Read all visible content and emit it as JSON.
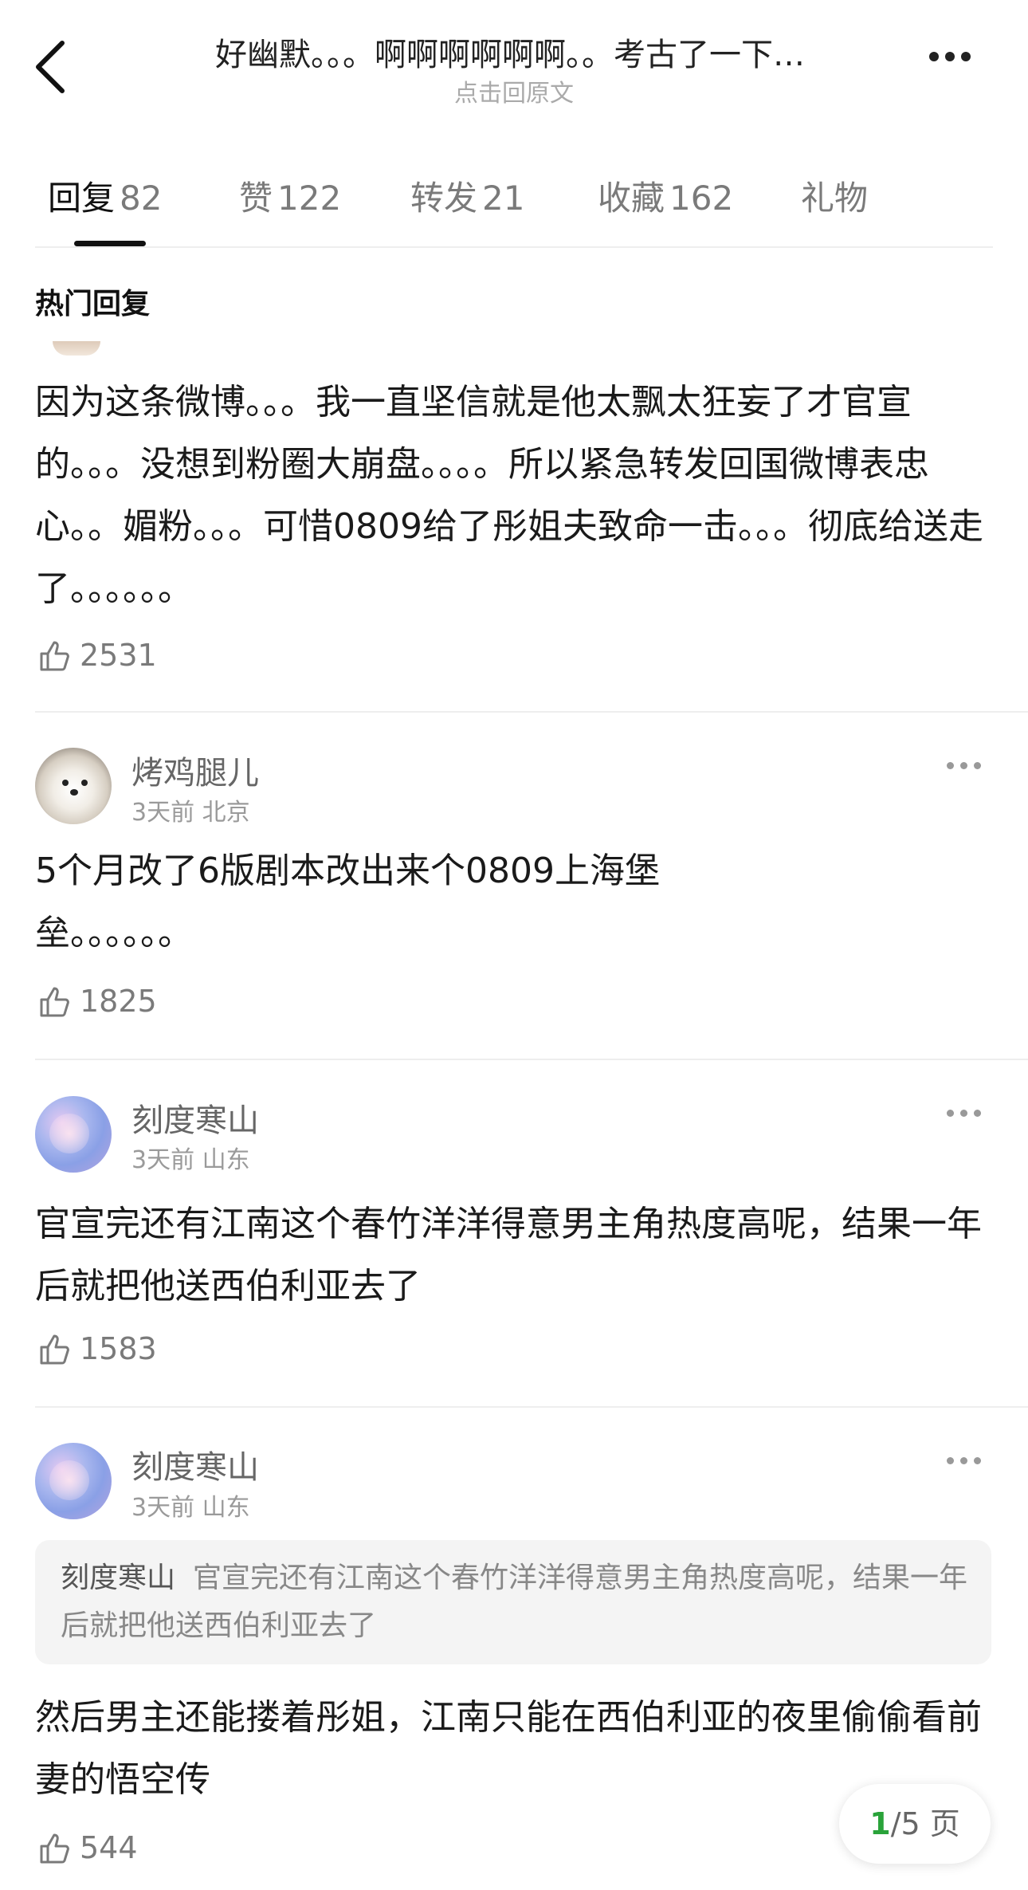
{
  "header": {
    "title": "好幽默。。。啊啊啊啊啊啊。。考古了一下…",
    "subtitle": "点击回原文"
  },
  "tabs": [
    {
      "label": "回复",
      "count": "82",
      "active": true
    },
    {
      "label": "赞",
      "count": "122"
    },
    {
      "label": "转发",
      "count": "21"
    },
    {
      "label": "收藏",
      "count": "162"
    },
    {
      "label": "礼物",
      "count": ""
    }
  ],
  "section_label": "热门回复",
  "comments": [
    {
      "text": "因为这条微博。。。我一直坚信就是他太飘太狂妄了才官宣的。。。没想到粉圈大崩盘。。。。所以紧急转发回国微博表忠心。。媚粉。。。可惜0809给了彤姐夫致命一击。。。彻底给送走了。。。。。。",
      "likes": "2531"
    },
    {
      "user": "烤鸡腿儿",
      "meta": "3天前 北京",
      "text": "5个月改了6版剧本改出来个0809上海堡垒。。。。。。",
      "likes": "1825"
    },
    {
      "user": "刻度寒山",
      "meta": "3天前 山东",
      "text": "官宣完还有江南这个春竹洋洋得意男主角热度高呢，结果一年后就把他送西伯利亚去了",
      "likes": "1583"
    },
    {
      "user": "刻度寒山",
      "meta": "3天前 山东",
      "quote_user": "刻度寒山",
      "quote_text": "官宣完还有江南这个春竹洋洋得意男主角热度高呢，结果一年后就把他送西伯利亚去了",
      "text": "然后男主还能搂着彤姐，江南只能在西伯利亚的夜里偷偷看前妻的悟空传",
      "likes": "544"
    }
  ],
  "pager": {
    "current": "1",
    "total_text": "/5 页"
  },
  "colors": {
    "accent_green": "#2aa33a",
    "muted": "#7a7a7a"
  }
}
